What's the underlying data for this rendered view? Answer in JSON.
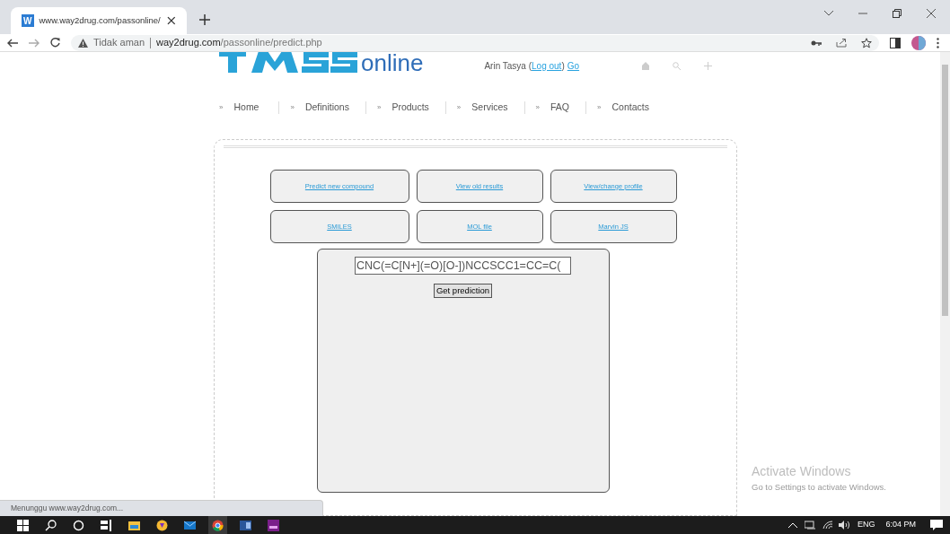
{
  "browser": {
    "tab": {
      "favicon": "W",
      "title": "www.way2drug.com/passonline/"
    },
    "address": {
      "security": "Tidak aman",
      "url_host": "way2drug.com",
      "url_path": "/passonline/predict.php"
    }
  },
  "header": {
    "logo_text": "online",
    "user": {
      "name": "Arin Tasya",
      "open": "(",
      "logout": "Log out",
      "close": ")",
      "go": "Go"
    }
  },
  "nav": [
    {
      "mark": "»",
      "label": "Home"
    },
    {
      "mark": "»",
      "label": "Definitions"
    },
    {
      "mark": "»",
      "label": "Products"
    },
    {
      "mark": "»",
      "label": "Services"
    },
    {
      "mark": "»",
      "label": "FAQ"
    },
    {
      "mark": "»",
      "label": "Contacts"
    }
  ],
  "actions": [
    "Predict new compound",
    "View old results",
    "View/change profile"
  ],
  "input_modes": [
    "SMILES",
    "MOL file",
    "Marvin JS"
  ],
  "form": {
    "value": "CNC(=C[N+](=O)[O-])NCCSCC1=CC=C(",
    "button": "Get prediction"
  },
  "status_bar": "Menunggu www.way2drug.com...",
  "activation": {
    "title": "Activate Windows",
    "subtitle": "Go to Settings to activate Windows."
  },
  "taskbar": {
    "language": "ENG",
    "time": "6:04 PM"
  }
}
